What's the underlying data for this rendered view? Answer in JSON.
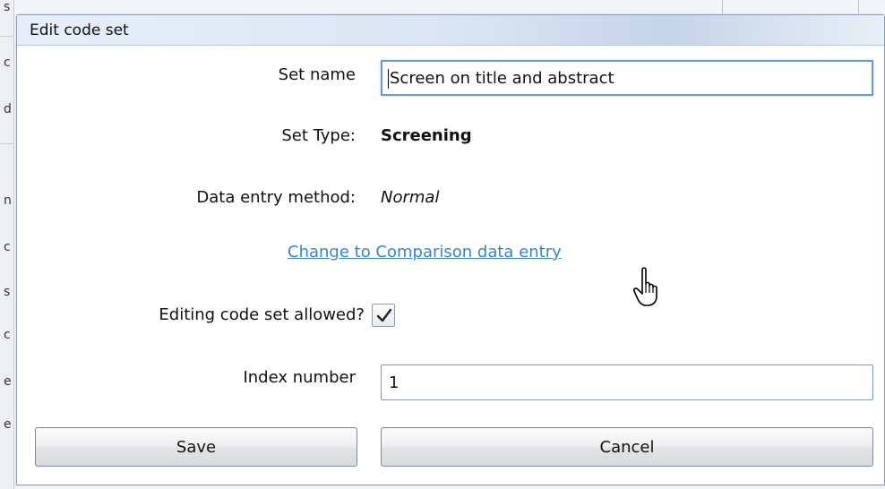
{
  "dialog": {
    "title": "Edit code set"
  },
  "form": {
    "set_name_label": "Set name",
    "set_name_value": "Screen on title and abstract",
    "set_type_label": "Set Type:",
    "set_type_value": "Screening",
    "data_entry_label": "Data entry method:",
    "data_entry_value": "Normal",
    "change_link": "Change to Comparison data entry",
    "editing_allowed_label": "Editing code set allowed?",
    "editing_allowed_checked": true,
    "index_number_label": "Index number",
    "index_number_value": "1"
  },
  "buttons": {
    "save_label": "Save",
    "cancel_label": "Cancel"
  },
  "background": {
    "left_letters": [
      "s",
      "c",
      "d",
      "n",
      "c",
      "s",
      "c",
      "e",
      "e"
    ]
  },
  "colors": {
    "link": "#3b84c5",
    "focus_border": "#6b9bd2"
  }
}
